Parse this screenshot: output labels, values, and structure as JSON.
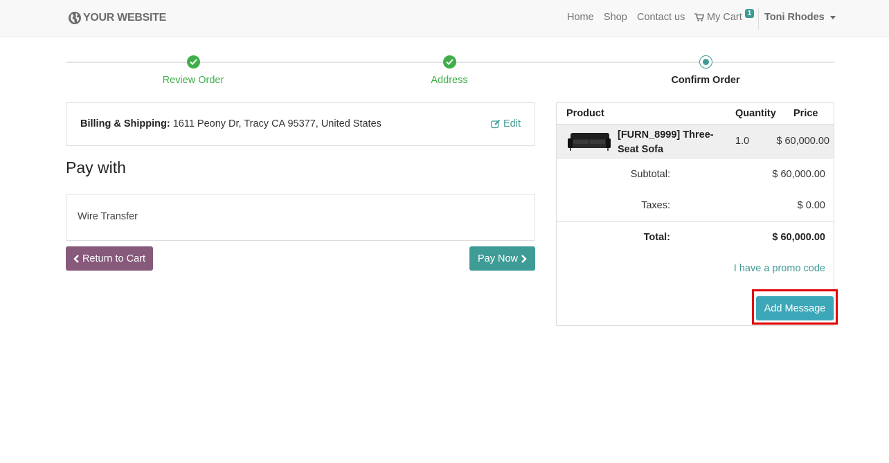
{
  "navbar": {
    "logo_text": "YOUR WEBSITE",
    "logo_icon": "globe-icon",
    "links": [
      "Home",
      "Shop",
      "Contact us"
    ],
    "cart_label": "My Cart",
    "cart_icon": "cart-icon",
    "cart_count": "1",
    "user_name": "Toni Rhodes"
  },
  "wizard": {
    "steps": [
      {
        "label": "Review Order",
        "state": "done"
      },
      {
        "label": "Address",
        "state": "done"
      },
      {
        "label": "Confirm Order",
        "state": "active"
      }
    ]
  },
  "billing": {
    "label": "Billing & Shipping:",
    "address": "1611 Peony Dr, Tracy CA 95377, United States",
    "edit_label": "Edit"
  },
  "payment": {
    "heading": "Pay with",
    "option": "Wire Transfer",
    "return_label": "Return to Cart",
    "pay_label": "Pay Now"
  },
  "summary": {
    "headers": {
      "product": "Product",
      "quantity": "Quantity",
      "price": "Price"
    },
    "items": [
      {
        "name": "[FURN_8999] Three-Seat Sofa",
        "quantity": "1.0",
        "price": "$ 60,000.00"
      }
    ],
    "subtotal_label": "Subtotal:",
    "subtotal_value": "$ 60,000.00",
    "taxes_label": "Taxes:",
    "taxes_value": "$ 0.00",
    "total_label": "Total:",
    "total_value": "$ 60,000.00",
    "promo_label": "I have a promo code",
    "message_label": "Add Message"
  },
  "colors": {
    "accent": "#3f9b96",
    "done_green": "#3fae49",
    "return_button": "#875a7b",
    "message_button": "#3ba7b8",
    "highlight": "#e00000"
  }
}
